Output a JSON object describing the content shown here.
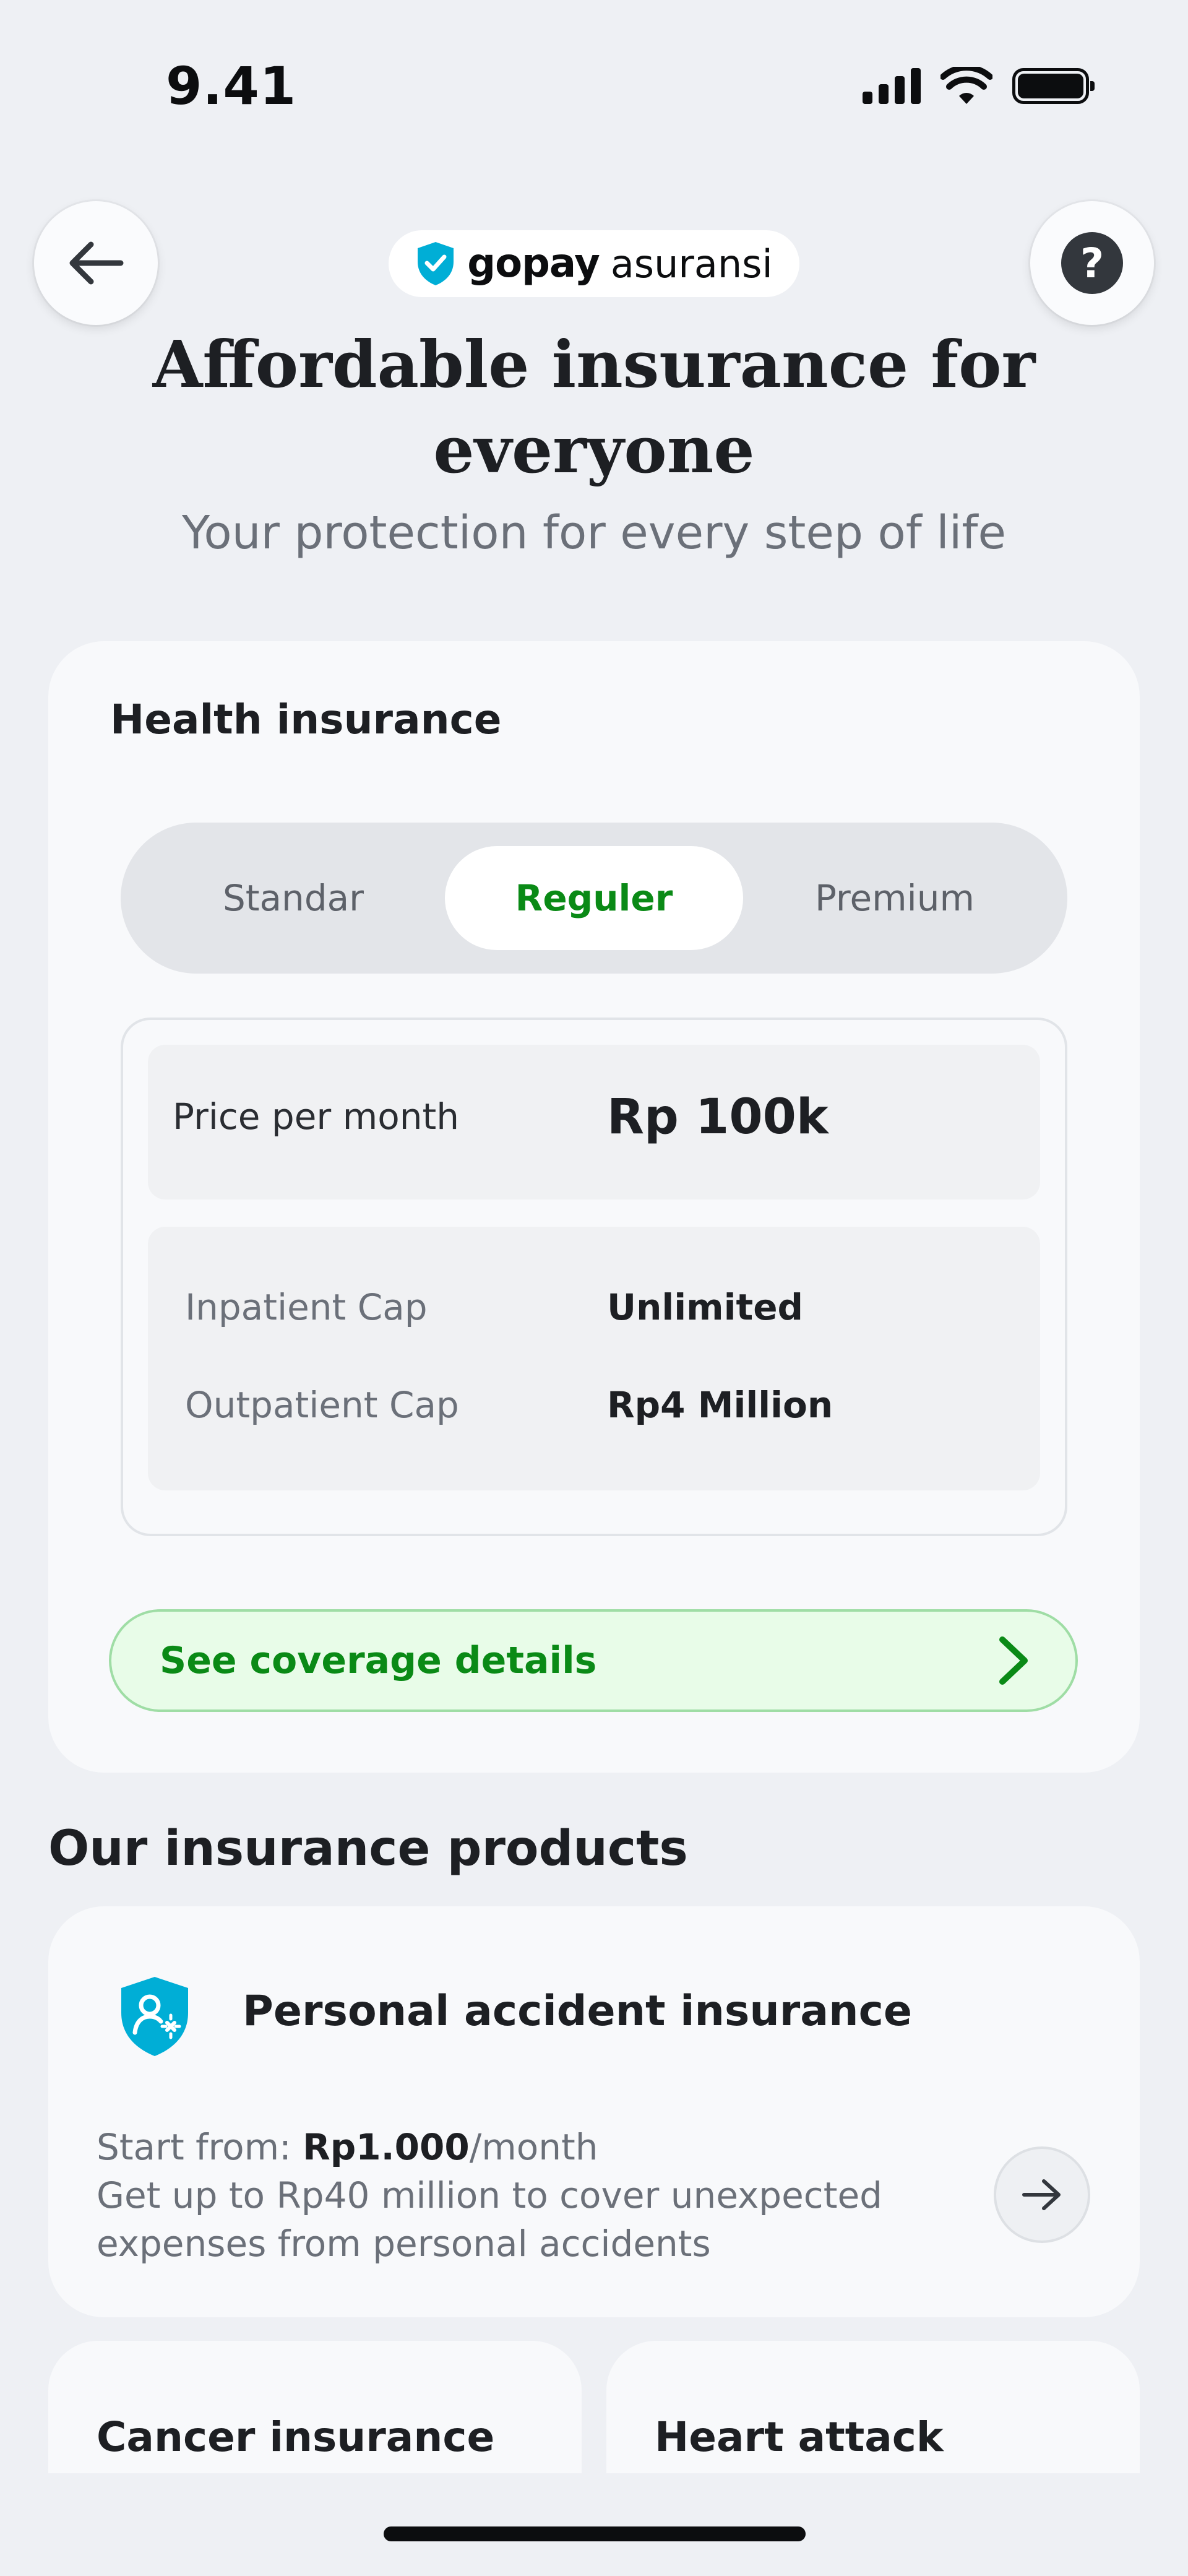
{
  "status_bar": {
    "time": "9.41",
    "icons": [
      "signal-icon",
      "wifi-icon",
      "battery-icon"
    ]
  },
  "header": {
    "back_icon": "arrow-left-icon",
    "help_icon": "question-mark-icon",
    "help_glyph": "?",
    "brand": {
      "logo_icon": "shield-check-icon",
      "name": "gopay",
      "suffix": "asuransi"
    }
  },
  "hero": {
    "title": "Affordable insurance for everyone",
    "subtitle": "Your protection for every step of life"
  },
  "health_card": {
    "title": "Health insurance",
    "tabs": [
      {
        "label": "Standar",
        "selected": false
      },
      {
        "label": "Reguler",
        "selected": true
      },
      {
        "label": "Premium",
        "selected": false
      }
    ],
    "price_label": "Price per month",
    "price_value": "Rp 100k",
    "caps": [
      {
        "label": "Inpatient Cap",
        "value": "Unlimited"
      },
      {
        "label": "Outpatient Cap",
        "value": "Rp4 Million"
      }
    ],
    "coverage_button": "See coverage details",
    "coverage_icon": "chevron-right-icon"
  },
  "products": {
    "section_title": "Our insurance products",
    "personal_accident": {
      "icon": "shield-person-icon",
      "title": "Personal accident insurance",
      "start_prefix": "Start from: ",
      "start_price": "Rp1.000",
      "start_suffix": "/month",
      "description": "Get up to Rp40 million to cover unexpected expenses from personal accidents",
      "arrow_icon": "arrow-right-icon"
    },
    "cancer": {
      "title": "Cancer insurance"
    },
    "heart_attack": {
      "title": "Heart attack insurance"
    }
  },
  "colors": {
    "accent_green": "#0A8A16",
    "brand_blue": "#00AED6",
    "background": "#EEF0F4",
    "card": "#F8F9FB"
  }
}
